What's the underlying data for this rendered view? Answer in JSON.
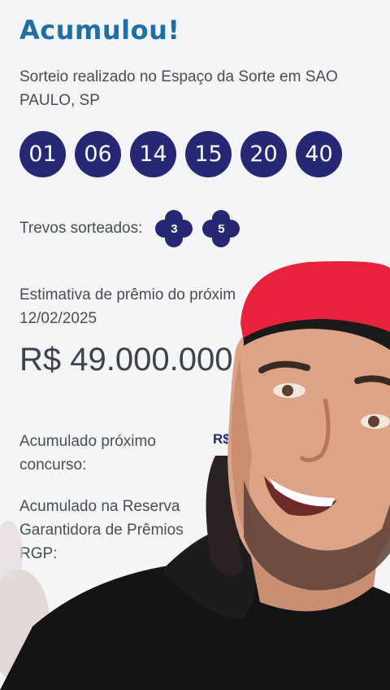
{
  "result": {
    "title": "Acumulou!",
    "location": "Sorteio realizado no Espaço da Sorte em SAO PAULO, SP",
    "numbers": [
      "01",
      "06",
      "14",
      "15",
      "20",
      "40"
    ]
  },
  "trevos": {
    "label": "Trevos sorteados:",
    "values": [
      "3",
      "5"
    ]
  },
  "estimate": {
    "label": "Estimativa de prêmio do próxim",
    "date": "12/02/2025",
    "value": "R$ 49.000.000,0"
  },
  "accumulated_next": {
    "label_line1": "Acumulado próximo",
    "label_line2": "concurso:",
    "value": "R$"
  },
  "accumulated_rgp": {
    "label_line1": "Acumulado na Reserva",
    "label_line2": "Garantidora de Prêmios",
    "label_line3": "RGP:"
  },
  "colors": {
    "title": "#1f6fa6",
    "ball": "#262873",
    "text": "#4a4d55",
    "cap": "#e8213c",
    "shirt": "#141414"
  }
}
